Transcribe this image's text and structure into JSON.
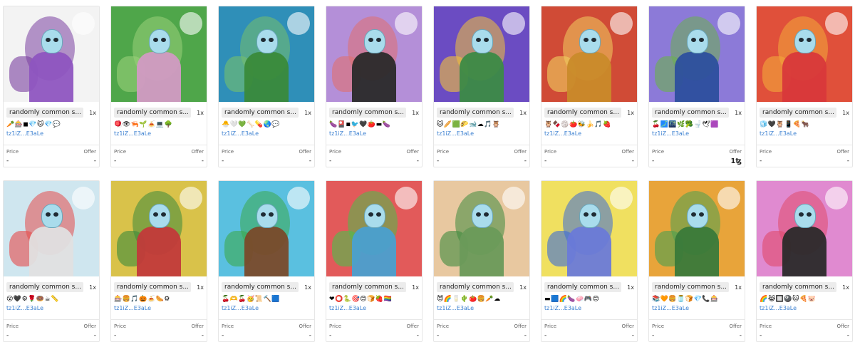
{
  "cards": [
    {
      "title": "randomly common s...",
      "qty": "1x",
      "emojis": "🥕🎰◼💎🐱💎💬",
      "owner": "tz1iZ...E3aLe",
      "price_label": "Price",
      "offer_label": "Offer",
      "price": "-",
      "offer": "-",
      "bg": "#f3f3f3",
      "accent": "#7a3fa0",
      "body": "#8e55c0"
    },
    {
      "title": "randomly common s...",
      "qty": "1x",
      "emojis": "🪀👁🦐🌱🍝💻🌳",
      "owner": "tz1iZ...E3aLe",
      "price_label": "Price",
      "offer_label": "Offer",
      "price": "-",
      "offer": "-",
      "bg": "#4fa64a",
      "accent": "#9ad07a",
      "body": "#d29ac3"
    },
    {
      "title": "randomly common s...",
      "qty": "1x",
      "emojis": "🐣🤍💚🦴💊🌏💬",
      "owner": "tz1iZ...E3aLe",
      "price_label": "Price",
      "offer_label": "Offer",
      "price": "-",
      "offer": "-",
      "bg": "#2f8fb8",
      "accent": "#77c06a",
      "body": "#3a8a3a"
    },
    {
      "title": "randomly common s...",
      "qty": "1x",
      "emojis": "🍆🎴◾🐦🖤🍅▬🍆",
      "owner": "tz1iZ...E3aLe",
      "price_label": "Price",
      "offer_label": "Offer",
      "price": "-",
      "offer": "-",
      "bg": "#b48fd8",
      "accent": "#e07070",
      "body": "#2a2a2a"
    },
    {
      "title": "randomly common s...",
      "qty": "1x",
      "emojis": "🐱🥖🟩🌮🐋☁🎵🦉",
      "owner": "tz1iZ...E3aLe",
      "price_label": "Price",
      "offer_label": "Offer",
      "price": "-",
      "offer": "-",
      "bg": "#6b4cc2",
      "accent": "#f2c23a",
      "body": "#3c8a46"
    },
    {
      "title": "randomly common s...",
      "qty": "1x",
      "emojis": "🦉🍫🏐🍅🐝🍌🎵🍓",
      "owner": "tz1iZ...E3aLe",
      "price_label": "Price",
      "offer_label": "Offer",
      "price": "-",
      "offer": "-",
      "bg": "#d04b36",
      "accent": "#f0d060",
      "body": "#c98a2a"
    },
    {
      "title": "randomly common s...",
      "qty": "1x",
      "emojis": "🍒🗾🌃🌿🥦🚽🕊🟪",
      "owner": "tz1iZ...E3aLe",
      "price_label": "Price",
      "offer_label": "Offer",
      "price": "-",
      "offer": "1ꜩ",
      "bg": "#8c7ad8",
      "accent": "#6ab04c",
      "body": "#2d4f9e"
    },
    {
      "title": "randomly common s...",
      "qty": "1x",
      "emojis": "🧊🖤🦉📱🍕🐂",
      "owner": "tz1iZ...E3aLe",
      "price_label": "Price",
      "offer_label": "Offer",
      "price": "-",
      "offer": "-",
      "bg": "#e0503a",
      "accent": "#f2a93a",
      "body": "#d8383a"
    },
    {
      "title": "randomly common s...",
      "qty": "1x",
      "emojis": "😮🖤⚙🌹🍩☕📏",
      "owner": "tz1iZ...E3aLe",
      "price_label": "Price",
      "offer_label": "Offer",
      "price": "-",
      "offer": "-",
      "bg": "#cfe6ef",
      "accent": "#e64a4a",
      "body": "#e0e0e0"
    },
    {
      "title": "randomly common s...",
      "qty": "1x",
      "emojis": "🎰🍔🎵🎃🍝🌭⚙",
      "owner": "tz1iZ...E3aLe",
      "price_label": "Price",
      "offer_label": "Offer",
      "price": "-",
      "offer": "-",
      "bg": "#d9c24a",
      "accent": "#3c8a3c",
      "body": "#c23a3a"
    },
    {
      "title": "randomly common s...",
      "qty": "1x",
      "emojis": "🍒🫶🍒🥳📜🔨🟦",
      "owner": "tz1iZ...E3aLe",
      "price_label": "Price",
      "offer_label": "Offer",
      "price": "-",
      "offer": "-",
      "bg": "#5ac0e0",
      "accent": "#3ca84c",
      "body": "#7a4a2a"
    },
    {
      "title": "randomly common s...",
      "qty": "1x",
      "emojis": "❤⭕🐍🎯😊🍞🍓🏳️‍🌈",
      "owner": "tz1iZ...E3aLe",
      "price_label": "Price",
      "offer_label": "Offer",
      "price": "-",
      "offer": "-",
      "bg": "#e25a5a",
      "accent": "#4bc04b",
      "body": "#4aa0d0"
    },
    {
      "title": "randomly common s...",
      "qty": "1x",
      "emojis": "😈🌈🥛🌵🍅🍔🥕☁",
      "owner": "tz1iZ...E3aLe",
      "price_label": "Price",
      "offer_label": "Offer",
      "price": "-",
      "offer": "-",
      "bg": "#e8c8a0",
      "accent": "#3e8a3e",
      "body": "#6a9a5a"
    },
    {
      "title": "randomly common s...",
      "qty": "1x",
      "emojis": "▬🟦🌈🍆🧼🎮😊",
      "owner": "tz1iZ...E3aLe",
      "price_label": "Price",
      "offer_label": "Offer",
      "price": "-",
      "offer": "-",
      "bg": "#f0e060",
      "accent": "#3a6ad8",
      "body": "#6a7ad8"
    },
    {
      "title": "randomly common s...",
      "qty": "1x",
      "emojis": "📚🧡🍔🫙🍞💎📞🎰",
      "owner": "tz1iZ...E3aLe",
      "price_label": "Price",
      "offer_label": "Offer",
      "price": "-",
      "offer": "-",
      "bg": "#e8a43a",
      "accent": "#4aa050",
      "body": "#3a7a3a"
    },
    {
      "title": "randomly common s...",
      "qty": "1x",
      "emojis": "🌈😹🔲🎱🐱🍕🐷",
      "owner": "tz1iZ...E3aLe",
      "price_label": "Price",
      "offer_label": "Offer",
      "price": "-",
      "offer": "-",
      "bg": "#e08ad0",
      "accent": "#e04a6a",
      "body": "#2a2a2a"
    }
  ]
}
